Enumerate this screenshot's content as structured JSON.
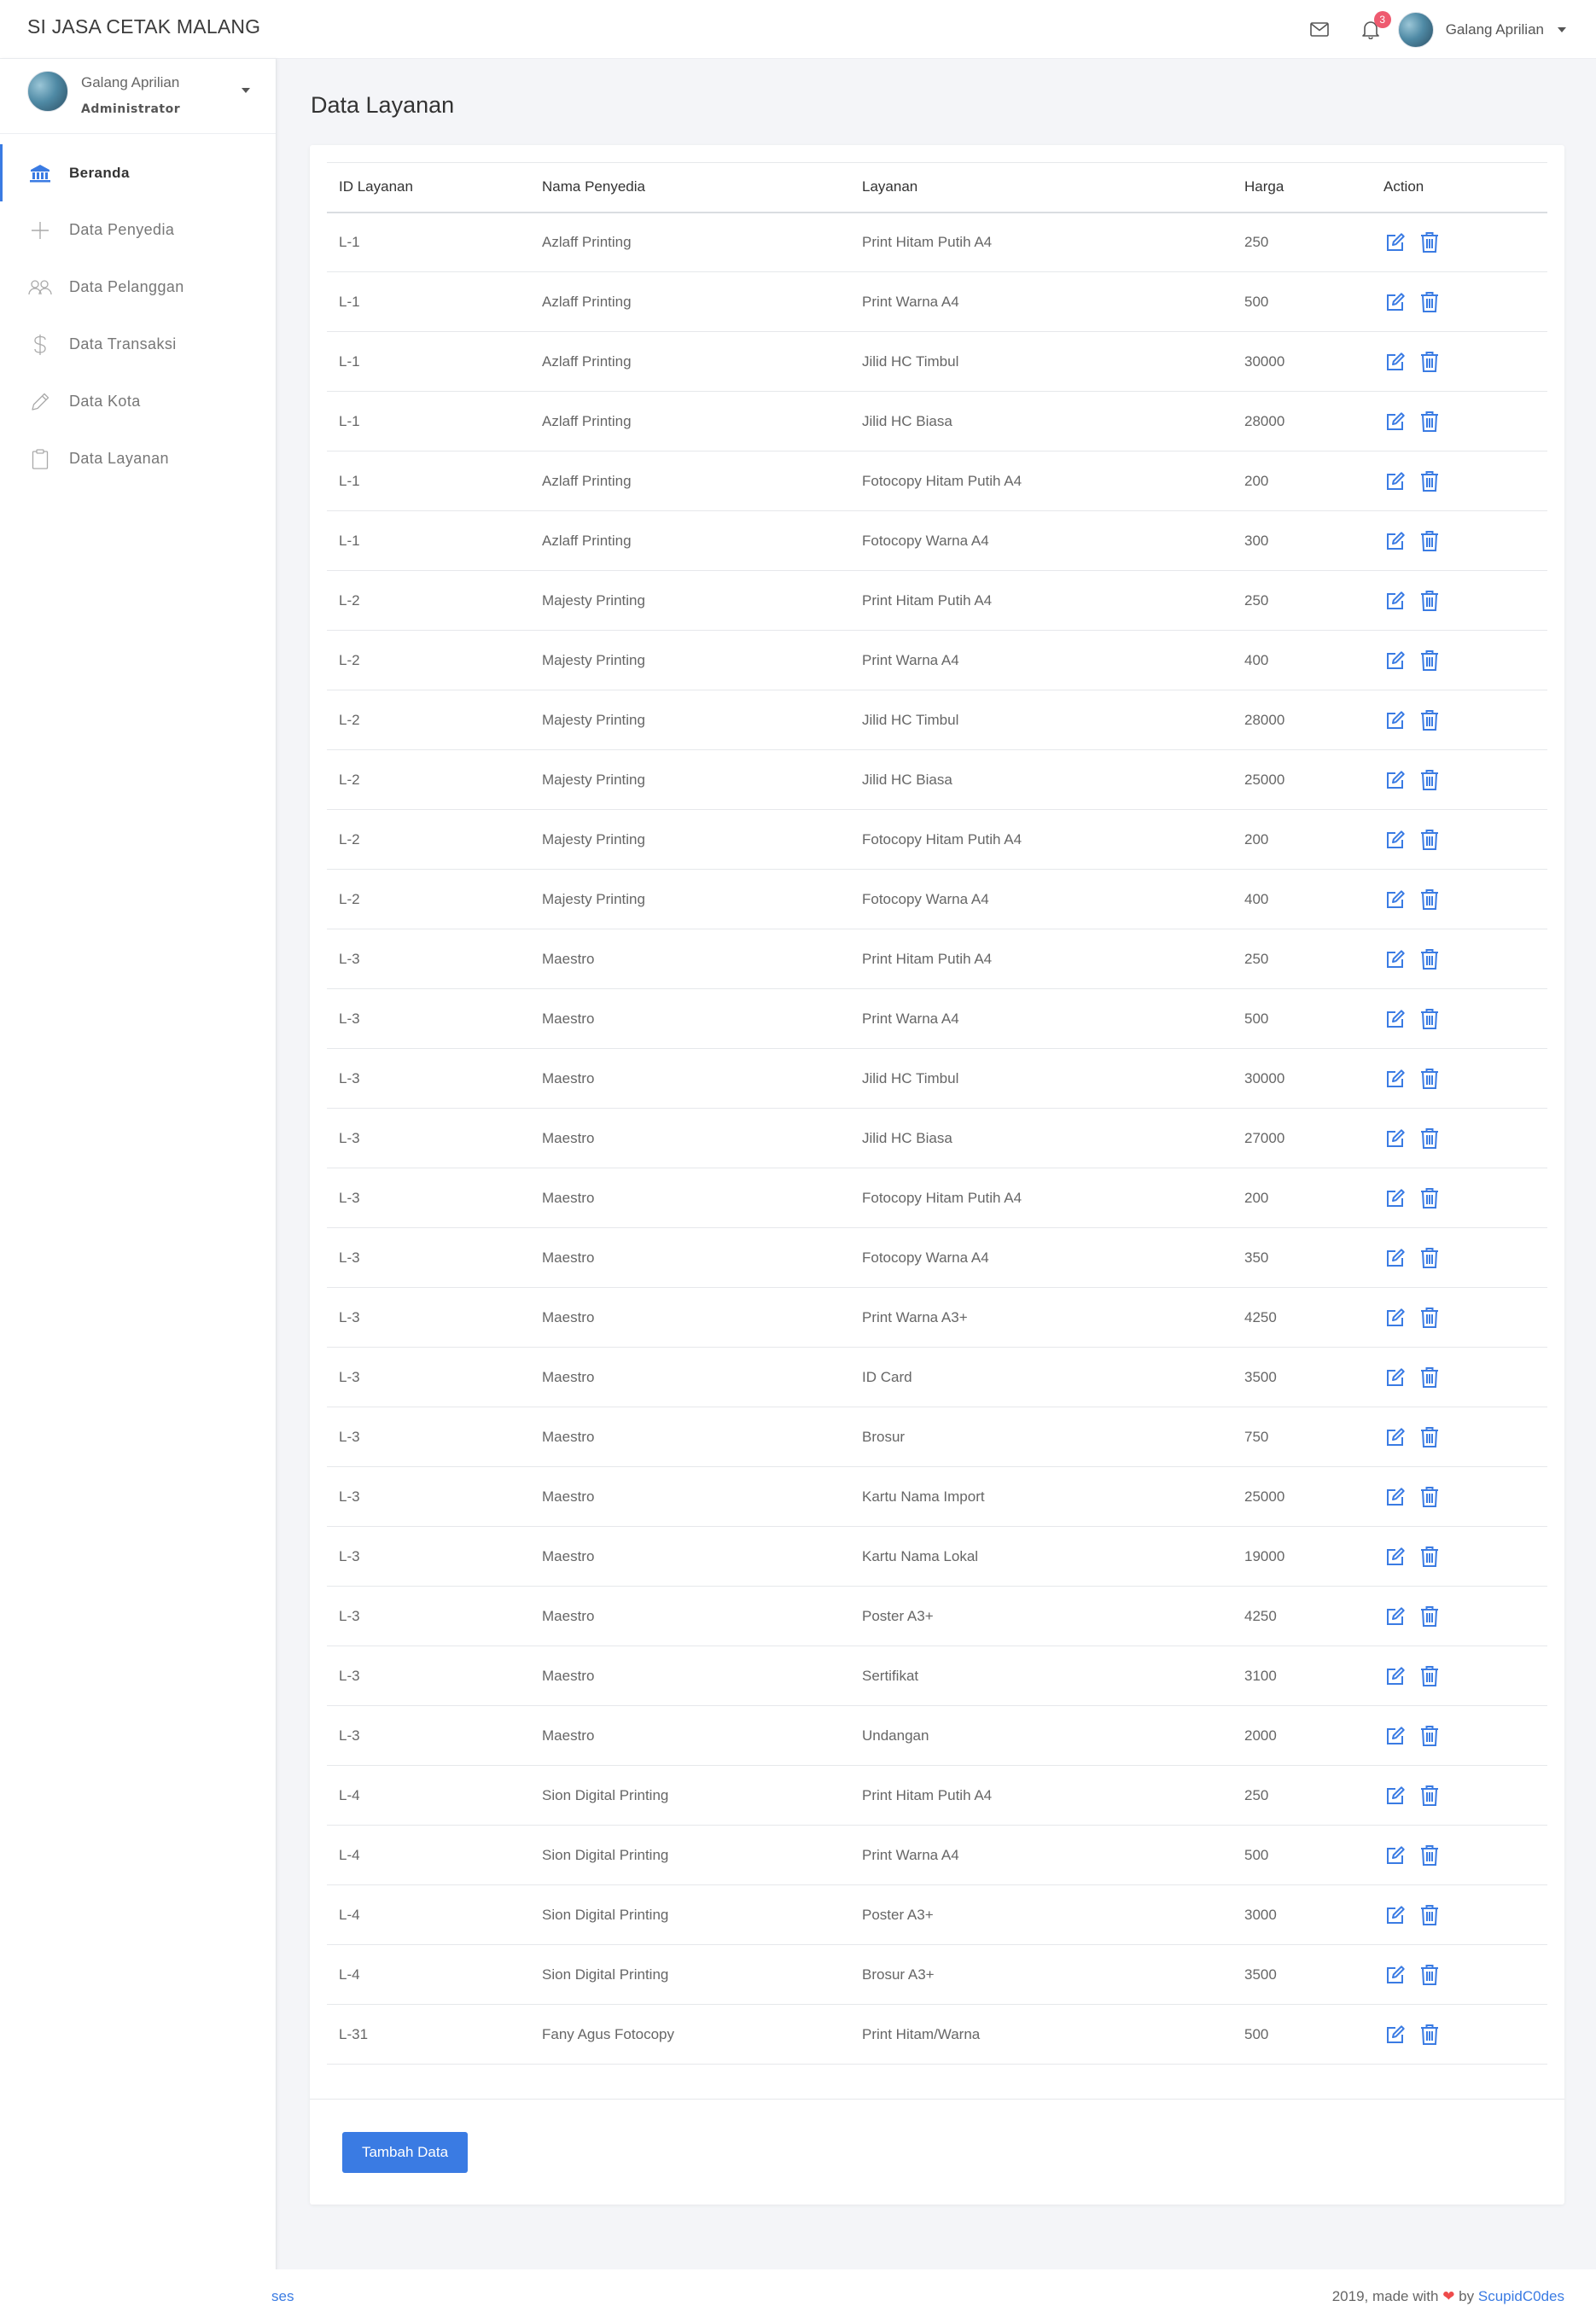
{
  "app": {
    "brand": "SI JASA CETAK MALANG"
  },
  "navbar": {
    "notification_count": "3",
    "user_name": "Galang Aprilian"
  },
  "sidebar": {
    "profile": {
      "name": "Galang Aprilian",
      "role": "Administrator"
    },
    "items": [
      {
        "label": "Beranda",
        "icon": "bank-icon"
      },
      {
        "label": "Data Penyedia",
        "icon": "plus-icon"
      },
      {
        "label": "Data Pelanggan",
        "icon": "users-icon"
      },
      {
        "label": "Data Transaksi",
        "icon": "dollar-icon"
      },
      {
        "label": "Data Kota",
        "icon": "pencil-icon"
      },
      {
        "label": "Data Layanan",
        "icon": "clipboard-icon"
      }
    ]
  },
  "main": {
    "title": "Data Layanan",
    "table": {
      "headers": [
        "ID Layanan",
        "Nama Penyedia",
        "Layanan",
        "Harga",
        "Action"
      ],
      "rows": [
        [
          "L-1",
          "Azlaff Printing",
          "Print Hitam Putih A4",
          "250"
        ],
        [
          "L-1",
          "Azlaff Printing",
          "Print Warna A4",
          "500"
        ],
        [
          "L-1",
          "Azlaff Printing",
          "Jilid HC Timbul",
          "30000"
        ],
        [
          "L-1",
          "Azlaff Printing",
          "Jilid HC Biasa",
          "28000"
        ],
        [
          "L-1",
          "Azlaff Printing",
          "Fotocopy Hitam Putih A4",
          "200"
        ],
        [
          "L-1",
          "Azlaff Printing",
          "Fotocopy Warna A4",
          "300"
        ],
        [
          "L-2",
          "Majesty Printing",
          "Print Hitam Putih A4",
          "250"
        ],
        [
          "L-2",
          "Majesty Printing",
          "Print Warna A4",
          "400"
        ],
        [
          "L-2",
          "Majesty Printing",
          "Jilid HC Timbul",
          "28000"
        ],
        [
          "L-2",
          "Majesty Printing",
          "Jilid HC Biasa",
          "25000"
        ],
        [
          "L-2",
          "Majesty Printing",
          "Fotocopy Hitam Putih A4",
          "200"
        ],
        [
          "L-2",
          "Majesty Printing",
          "Fotocopy Warna A4",
          "400"
        ],
        [
          "L-3",
          "Maestro",
          "Print Hitam Putih A4",
          "250"
        ],
        [
          "L-3",
          "Maestro",
          "Print Warna A4",
          "500"
        ],
        [
          "L-3",
          "Maestro",
          "Jilid HC Timbul",
          "30000"
        ],
        [
          "L-3",
          "Maestro",
          "Jilid HC Biasa",
          "27000"
        ],
        [
          "L-3",
          "Maestro",
          "Fotocopy Hitam Putih A4",
          "200"
        ],
        [
          "L-3",
          "Maestro",
          "Fotocopy Warna A4",
          "350"
        ],
        [
          "L-3",
          "Maestro",
          "Print Warna A3+",
          "4250"
        ],
        [
          "L-3",
          "Maestro",
          "ID Card",
          "3500"
        ],
        [
          "L-3",
          "Maestro",
          "Brosur",
          "750"
        ],
        [
          "L-3",
          "Maestro",
          "Kartu Nama Import",
          "25000"
        ],
        [
          "L-3",
          "Maestro",
          "Kartu Nama Lokal",
          "19000"
        ],
        [
          "L-3",
          "Maestro",
          "Poster A3+",
          "4250"
        ],
        [
          "L-3",
          "Maestro",
          "Sertifikat",
          "3100"
        ],
        [
          "L-3",
          "Maestro",
          "Undangan",
          "2000"
        ],
        [
          "L-4",
          "Sion Digital Printing",
          "Print Hitam Putih A4",
          "250"
        ],
        [
          "L-4",
          "Sion Digital Printing",
          "Print Warna A4",
          "500"
        ],
        [
          "L-4",
          "Sion Digital Printing",
          "Poster A3+",
          "3000"
        ],
        [
          "L-4",
          "Sion Digital Printing",
          "Brosur A3+",
          "3500"
        ],
        [
          "L-31",
          "Fany Agus Fotocopy",
          "Print Hitam/Warna",
          "500"
        ]
      ]
    },
    "add_button": "Tambah Data"
  },
  "footer": {
    "left_link": "ses",
    "made_with": "2019, made with",
    "heart": "❤",
    "by": "by",
    "author": "ScupidC0des"
  },
  "colors": {
    "accent": "#3a7be3",
    "badge": "#ee5a6f",
    "heart": "#ef4b4b"
  }
}
